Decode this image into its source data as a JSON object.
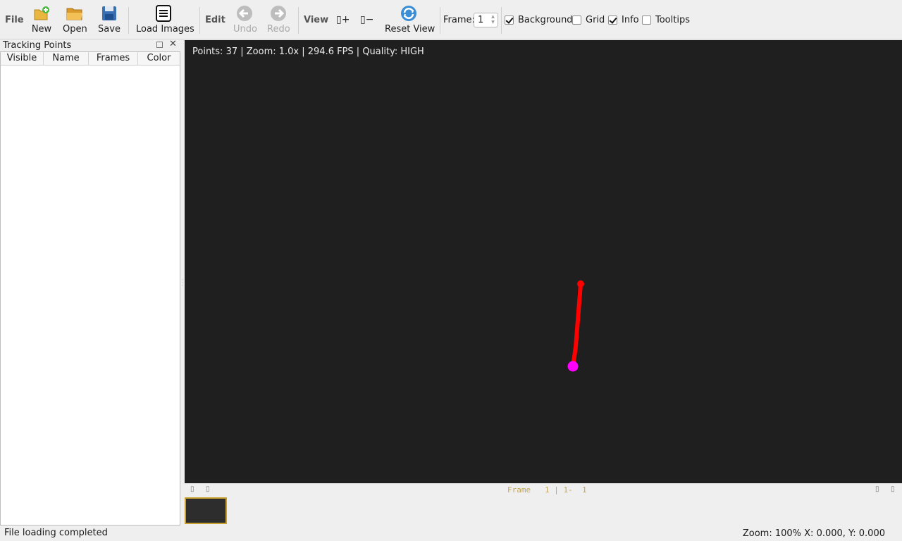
{
  "toolbar": {
    "file_group": "File",
    "new_label": "New",
    "open_label": "Open",
    "save_label": "Save",
    "load_images_label": "Load Images",
    "edit_group": "Edit",
    "undo_label": "Undo",
    "redo_label": "Redo",
    "view_group": "View",
    "zoom_in_label": "▯+",
    "zoom_out_label": "▯−",
    "reset_view_label": "Reset View",
    "frame_label": "Frame:",
    "frame_value": "1",
    "background_label": "Background",
    "background_checked": true,
    "grid_label": "Grid",
    "grid_checked": false,
    "info_label": "Info",
    "info_checked": true,
    "tooltips_label": "Tooltips",
    "tooltips_checked": false
  },
  "dock": {
    "title": "Tracking Points",
    "columns": [
      "Visible",
      "Name",
      "Frames",
      "Color"
    ],
    "close_glyph": "✕"
  },
  "canvas": {
    "info_text": "Points: 37 | Zoom: 1.0x | 294.6 FPS | Quality: HIGH",
    "track_color": "#ff0000",
    "current_point_color": "#ff00ff",
    "background_color": "#1f1f1f"
  },
  "timeline": {
    "frame_info": "Frame   1 | 1-  1",
    "left_buttons": [
      "▯",
      "▯"
    ],
    "right_buttons": [
      "▯",
      "▯"
    ]
  },
  "status": {
    "message": "File loading completed",
    "right": "Zoom: 100%  X: 0.000, Y: 0.000"
  }
}
